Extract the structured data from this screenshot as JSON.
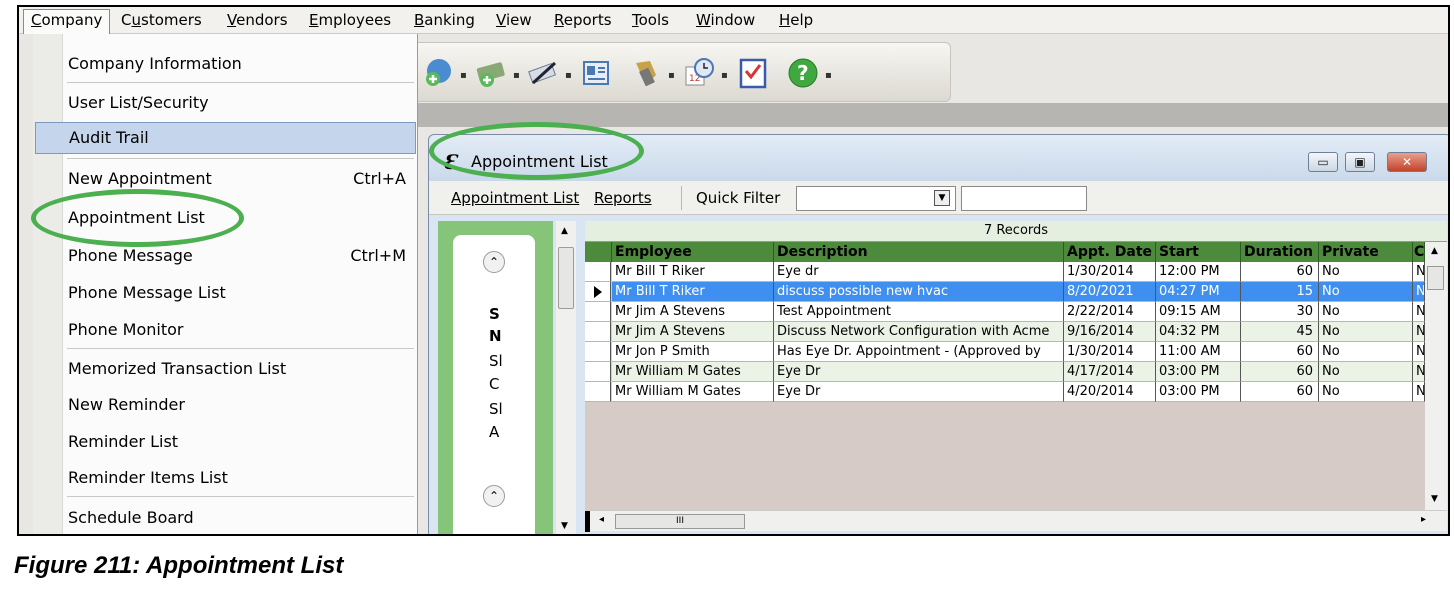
{
  "menubar": {
    "items": [
      {
        "label": "Company",
        "underline": "C"
      },
      {
        "label": "Customers",
        "underline": "u"
      },
      {
        "label": "Vendors",
        "underline": "V"
      },
      {
        "label": "Employees",
        "underline": "E"
      },
      {
        "label": "Banking",
        "underline": "B"
      },
      {
        "label": "View",
        "underline": "V"
      },
      {
        "label": "Reports",
        "underline": "R"
      },
      {
        "label": "Tools",
        "underline": "T"
      },
      {
        "label": "Window",
        "underline": "W"
      },
      {
        "label": "Help",
        "underline": "H"
      }
    ],
    "active": "Company"
  },
  "company_menu": {
    "items": [
      {
        "label": "Company Information",
        "shortcut": ""
      },
      {
        "label": "User List/Security",
        "shortcut": ""
      },
      {
        "label": "Audit Trail",
        "shortcut": "",
        "highlighted": true
      },
      {
        "label": "New Appointment",
        "shortcut": "Ctrl+A"
      },
      {
        "label": "Appointment List",
        "shortcut": ""
      },
      {
        "label": "Phone Message",
        "shortcut": "Ctrl+M"
      },
      {
        "label": "Phone Message List",
        "shortcut": ""
      },
      {
        "label": "Phone Monitor",
        "shortcut": ""
      },
      {
        "label": "Memorized Transaction List",
        "shortcut": ""
      },
      {
        "label": "New Reminder",
        "shortcut": ""
      },
      {
        "label": "Reminder List",
        "shortcut": ""
      },
      {
        "label": "Reminder Items List",
        "shortcut": ""
      },
      {
        "label": "Schedule Board",
        "shortcut": ""
      }
    ]
  },
  "toolbar": {
    "icons": [
      "add-customer-icon",
      "money-add-icon",
      "write-check-icon",
      "address-card-icon",
      "stamp-icon",
      "calendar-clock-icon",
      "checklist-icon",
      "help-icon"
    ]
  },
  "appt_window": {
    "title": "Appointment List",
    "menu": {
      "appointment_list": "Appointment List",
      "reports": "Reports",
      "quick_filter": "Quick Filter"
    },
    "minimize": "▭",
    "restore": "▣",
    "close": "✕"
  },
  "left_panel": {
    "letters": [
      "S",
      "N",
      "Sl",
      "C",
      "Sl",
      "A"
    ]
  },
  "grid": {
    "record_count": "7 Records",
    "columns": [
      "Employee",
      "Description",
      "Appt. Date",
      "Start",
      "Duration",
      "Private",
      "C"
    ],
    "rows": [
      {
        "employee": "Mr Bill T Riker",
        "description": "Eye dr",
        "date": "1/30/2014",
        "start": "12:00 PM",
        "duration": "60",
        "private": "No",
        "c": "N"
      },
      {
        "employee": "Mr Bill T Riker",
        "description": "discuss possible new hvac",
        "date": "8/20/2021",
        "start": "04:27 PM",
        "duration": "15",
        "private": "No",
        "c": "N",
        "selected": true
      },
      {
        "employee": "Mr Jim A Stevens",
        "description": "Test Appointment",
        "date": "2/22/2014",
        "start": "09:15 AM",
        "duration": "30",
        "private": "No",
        "c": "N"
      },
      {
        "employee": "Mr Jim A Stevens",
        "description": "Discuss Network Configuration with Acme",
        "date": "9/16/2014",
        "start": "04:32 PM",
        "duration": "45",
        "private": "No",
        "c": "N"
      },
      {
        "employee": "Mr Jon P Smith",
        "description": "Has Eye Dr. Appointment - (Approved by",
        "date": "1/30/2014",
        "start": "11:00 AM",
        "duration": "60",
        "private": "No",
        "c": "N"
      },
      {
        "employee": "Mr William M Gates",
        "description": "Eye Dr",
        "date": "4/17/2014",
        "start": "03:00 PM",
        "duration": "60",
        "private": "No",
        "c": "N"
      },
      {
        "employee": "Mr William M Gates",
        "description": "Eye Dr",
        "date": "4/20/2014",
        "start": "03:00 PM",
        "duration": "60",
        "private": "No",
        "c": "N"
      }
    ]
  },
  "caption": "Figure 211: Appointment List"
}
